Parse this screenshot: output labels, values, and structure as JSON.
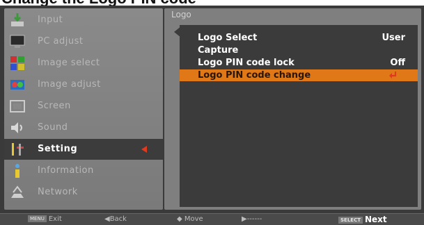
{
  "heading": "Change the Logo PIN code",
  "left_menu": {
    "items": [
      {
        "label": "Input",
        "icon": "input-icon"
      },
      {
        "label": "PC adjust",
        "icon": "pc-adjust-icon"
      },
      {
        "label": "Image select",
        "icon": "image-select-icon"
      },
      {
        "label": "Image adjust",
        "icon": "image-adjust-icon"
      },
      {
        "label": "Screen",
        "icon": "screen-icon"
      },
      {
        "label": "Sound",
        "icon": "sound-icon"
      },
      {
        "label": "Setting",
        "icon": "setting-icon",
        "active": true
      },
      {
        "label": "Information",
        "icon": "information-icon"
      },
      {
        "label": "Network",
        "icon": "network-icon"
      }
    ]
  },
  "submenu": {
    "title": "Logo",
    "rows": [
      {
        "label": "Logo Select",
        "value": "User"
      },
      {
        "label": "Capture",
        "value": ""
      },
      {
        "label": "Logo PIN code lock",
        "value": "Off"
      },
      {
        "label": "Logo PIN code change",
        "value": "",
        "highlighted": true
      }
    ]
  },
  "bottom_bar": {
    "exit_key": "MENU",
    "exit": "Exit",
    "back": "◀Back",
    "move": "◆ Move",
    "enter": "▶------",
    "next_key": "SELECT",
    "next": "Next"
  },
  "colors": {
    "highlight": "#e07818",
    "accent_marker": "#e03a1e",
    "panel_bg": "#7f7f7f",
    "submenu_bg": "#3b3b3b"
  }
}
